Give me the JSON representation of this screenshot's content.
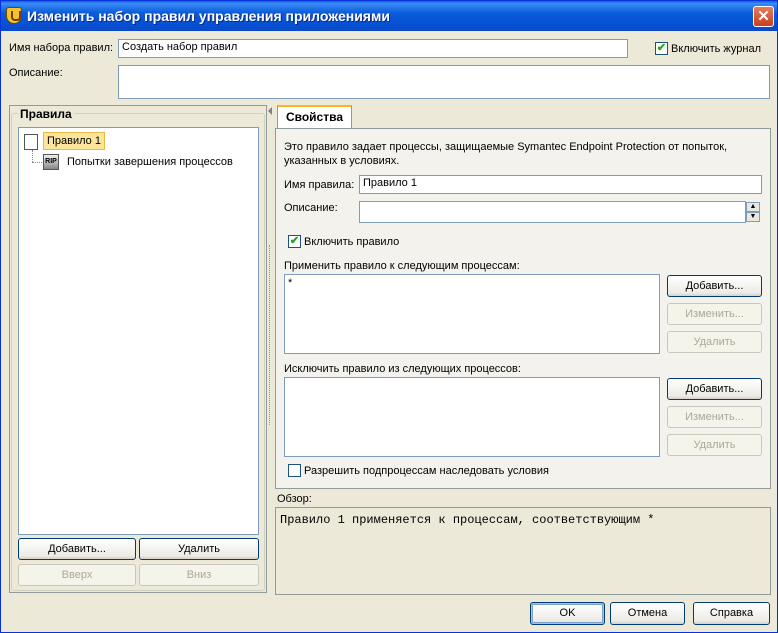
{
  "window": {
    "title": "Изменить набор правил управления приложениями",
    "close": "✕"
  },
  "top": {
    "ruleset_name_label": "Имя набора правил:",
    "ruleset_name_value": "Создать набор правил",
    "enable_log_label": "Включить журнал",
    "enable_log_checked": true,
    "description_label": "Описание:",
    "description_value": ""
  },
  "rules_panel": {
    "title": "Правила",
    "tree": [
      {
        "label": "Правило 1",
        "icon": "rule-icon",
        "selected": true
      },
      {
        "label": "Попытки завершения процессов",
        "icon": "rip-icon",
        "icon_text": "RIP"
      }
    ],
    "add_label": "Добавить...",
    "delete_label": "Удалить",
    "up_label": "Вверх",
    "down_label": "Вниз"
  },
  "properties": {
    "tab_label": "Свойства",
    "info_line1": "Это правило задает процессы, защищаемые Symantec Endpoint Protection от попыток,",
    "info_line2": "указанных в условиях.",
    "rule_name_label": "Имя правила:",
    "rule_name_value": "Правило 1",
    "description_label": "Описание:",
    "description_value": "",
    "enable_rule_label": "Включить правило",
    "enable_rule_checked": true,
    "apply_label": "Применить правило к следующим процессам:",
    "apply_list": [
      "*"
    ],
    "apply_add": "Добавить...",
    "apply_edit": "Изменить...",
    "apply_delete": "Удалить",
    "exclude_label": "Исключить правило из следующих процессов:",
    "exclude_list": [],
    "exclude_add": "Добавить...",
    "exclude_edit": "Изменить...",
    "exclude_delete": "Удалить",
    "inherit_label": "Разрешить подпроцессам наследовать условия",
    "inherit_checked": false
  },
  "summary": {
    "label": "Обзор:",
    "text": "Правило 1 применяется к процессам, соответствующим *"
  },
  "footer": {
    "ok": "OK",
    "cancel": "Отмена",
    "help": "Справка"
  }
}
